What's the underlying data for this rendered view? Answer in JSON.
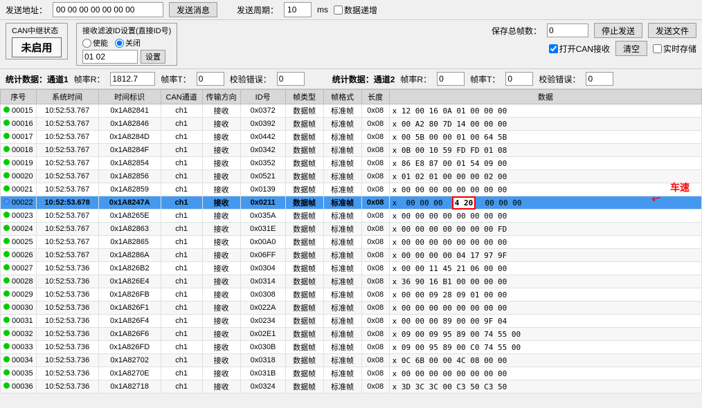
{
  "topbar": {
    "label_addr": "发送地址：",
    "addr_value": "00 00 00 00 00 00 00",
    "send_msg_btn": "发送消息",
    "label_period": "发送周期：",
    "period_value": "10",
    "period_unit": "ms",
    "checkbox_loop": "数据递增"
  },
  "can_status": {
    "section_label": "CAN中继状态",
    "status_value": "未启用"
  },
  "filter": {
    "section_label": "接收滤波ID设置(直接ID号)",
    "radio_enable": "使能",
    "radio_close": "关闭",
    "input_value": "01 02",
    "set_btn": "设置"
  },
  "right_controls": {
    "save_total_label": "保存总帧数：",
    "save_total_value": "0",
    "stop_send_btn": "停止发送",
    "send_file_btn": "发送文件",
    "open_can_label": "打开CAN接收",
    "clear_btn": "清空",
    "realtime_save_label": "实时存储"
  },
  "stats_ch1": {
    "label": "统计数据：通道1",
    "frame_rate_r_label": "帧率R：",
    "frame_rate_r": "1812.7",
    "frame_rate_t_label": "帧率T：",
    "frame_rate_t": "0",
    "check_err_label": "校验错误：",
    "check_err": "0"
  },
  "stats_ch2": {
    "label": "统计数据：通道2",
    "frame_rate_r_label": "帧率R：",
    "frame_rate_r": "0",
    "frame_rate_t_label": "帧率T：",
    "frame_rate_t": "0",
    "check_err_label": "校验错误：",
    "check_err": "0"
  },
  "table": {
    "headers": [
      "序号",
      "系统时间",
      "时间标识",
      "CAN通道",
      "传输方向",
      "ID号",
      "帧类型",
      "帧格式",
      "长度",
      "数据"
    ],
    "selected_row_index": 10,
    "rows": [
      {
        "id": "00015",
        "time": "10:52:53.767",
        "ts": "0x1A82841",
        "ch": "ch1",
        "dir": "接收",
        "msgid": "0x0372",
        "ftype": "数据帧",
        "fformat": "标准帧",
        "len": "0x08",
        "data": "x  12 00 16 0A 01 00 00 00",
        "dot": "green"
      },
      {
        "id": "00016",
        "time": "10:52:53.767",
        "ts": "0x1A82846",
        "ch": "ch1",
        "dir": "接收",
        "msgid": "0x0392",
        "ftype": "数据帧",
        "fformat": "标准帧",
        "len": "0x08",
        "data": "x  00 A2 80 7D 14 00 00 00",
        "dot": "green"
      },
      {
        "id": "00017",
        "time": "10:52:53.767",
        "ts": "0x1A8284D",
        "ch": "ch1",
        "dir": "接收",
        "msgid": "0x0442",
        "ftype": "数据帧",
        "fformat": "标准帧",
        "len": "0x08",
        "data": "x  00 5B 00 00 01 00 64 5B",
        "dot": "green"
      },
      {
        "id": "00018",
        "time": "10:52:53.767",
        "ts": "0x1A8284F",
        "ch": "ch1",
        "dir": "接收",
        "msgid": "0x0342",
        "ftype": "数据帧",
        "fformat": "标准帧",
        "len": "0x08",
        "data": "x  0B 00 10 59 FD FD 01 08",
        "dot": "green"
      },
      {
        "id": "00019",
        "time": "10:52:53.767",
        "ts": "0x1A82854",
        "ch": "ch1",
        "dir": "接收",
        "msgid": "0x0352",
        "ftype": "数据帧",
        "fformat": "标准帧",
        "len": "0x08",
        "data": "x  86 E8 87 00 01 54 09 00",
        "dot": "green"
      },
      {
        "id": "00020",
        "time": "10:52:53.767",
        "ts": "0x1A82856",
        "ch": "ch1",
        "dir": "接收",
        "msgid": "0x0521",
        "ftype": "数据帧",
        "fformat": "标准帧",
        "len": "0x08",
        "data": "x  01 02 01 00 00 00 02 00",
        "dot": "green"
      },
      {
        "id": "00021",
        "time": "10:52:53.767",
        "ts": "0x1A82859",
        "ch": "ch1",
        "dir": "接收",
        "msgid": "0x0139",
        "ftype": "数据帧",
        "fformat": "标准帧",
        "len": "0x08",
        "data": "x  00 00 00 00 00 00 00 00",
        "dot": "green"
      },
      {
        "id": "00022",
        "time": "10:52:53.678",
        "ts": "0x1A8247A",
        "ch": "ch1",
        "dir": "接收",
        "msgid": "0x0211",
        "ftype": "数据帧",
        "fformat": "标准帧",
        "len": "0x08",
        "data": "x  00 00 00  4 20  00 00 00",
        "dot": "blue",
        "selected": true,
        "highlight_col": 9
      },
      {
        "id": "00023",
        "time": "10:52:53.767",
        "ts": "0x1A8265E",
        "ch": "ch1",
        "dir": "接收",
        "msgid": "0x035A",
        "ftype": "数据帧",
        "fformat": "标准帧",
        "len": "0x08",
        "data": "x  00 00 00 00 00 00 00 00",
        "dot": "green"
      },
      {
        "id": "00024",
        "time": "10:52:53.767",
        "ts": "0x1A82863",
        "ch": "ch1",
        "dir": "接收",
        "msgid": "0x031E",
        "ftype": "数据帧",
        "fformat": "标准帧",
        "len": "0x08",
        "data": "x  00 00 00 00 00 00 00 FD",
        "dot": "green"
      },
      {
        "id": "00025",
        "time": "10:52:53.767",
        "ts": "0x1A82865",
        "ch": "ch1",
        "dir": "接收",
        "msgid": "0x00A0",
        "ftype": "数据帧",
        "fformat": "标准帧",
        "len": "0x08",
        "data": "x  00 00 00 00 00 00 00 00",
        "dot": "green"
      },
      {
        "id": "00026",
        "time": "10:52:53.767",
        "ts": "0x1A8286A",
        "ch": "ch1",
        "dir": "接收",
        "msgid": "0x06FF",
        "ftype": "数据帧",
        "fformat": "标准帧",
        "len": "0x08",
        "data": "x  00 00 00 00 04 17 97 9F",
        "dot": "green"
      },
      {
        "id": "00027",
        "time": "10:52:53.736",
        "ts": "0x1A826B2",
        "ch": "ch1",
        "dir": "接收",
        "msgid": "0x0304",
        "ftype": "数据帧",
        "fformat": "标准帧",
        "len": "0x08",
        "data": "x  00 00 11 45 21 06 00 00",
        "dot": "green"
      },
      {
        "id": "00028",
        "time": "10:52:53.736",
        "ts": "0x1A826E4",
        "ch": "ch1",
        "dir": "接收",
        "msgid": "0x0314",
        "ftype": "数据帧",
        "fformat": "标准帧",
        "len": "0x08",
        "data": "x  36 90 16 B1 00 00 00 00",
        "dot": "green"
      },
      {
        "id": "00029",
        "time": "10:52:53.736",
        "ts": "0x1A826FB",
        "ch": "ch1",
        "dir": "接收",
        "msgid": "0x0308",
        "ftype": "数据帧",
        "fformat": "标准帧",
        "len": "0x08",
        "data": "x  00 00 09 28 09 01 00 00",
        "dot": "green"
      },
      {
        "id": "00030",
        "time": "10:52:53.736",
        "ts": "0x1A826F1",
        "ch": "ch1",
        "dir": "接收",
        "msgid": "0x022A",
        "ftype": "数据帧",
        "fformat": "标准帧",
        "len": "0x08",
        "data": "x  00 00 00 00 00 00 00 00",
        "dot": "green"
      },
      {
        "id": "00031",
        "time": "10:52:53.736",
        "ts": "0x1A826F4",
        "ch": "ch1",
        "dir": "接收",
        "msgid": "0x0234",
        "ftype": "数据帧",
        "fformat": "标准帧",
        "len": "0x08",
        "data": "x  00 00 00 89 00 00 9F 04",
        "dot": "green"
      },
      {
        "id": "00032",
        "time": "10:52:53.736",
        "ts": "0x1A826F6",
        "ch": "ch1",
        "dir": "接收",
        "msgid": "0x02E1",
        "ftype": "数据帧",
        "fformat": "标准帧",
        "len": "0x08",
        "data": "x  09 00 09 95 89 00 74 55 00",
        "dot": "green"
      },
      {
        "id": "00033",
        "time": "10:52:53.736",
        "ts": "0x1A826FD",
        "ch": "ch1",
        "dir": "接收",
        "msgid": "0x030B",
        "ftype": "数据帧",
        "fformat": "标准帧",
        "len": "0x08",
        "data": "x  09 00 95 89 00 C0 74 55 00",
        "dot": "green"
      },
      {
        "id": "00034",
        "time": "10:52:53.736",
        "ts": "0x1A82702",
        "ch": "ch1",
        "dir": "接收",
        "msgid": "0x0318",
        "ftype": "数据帧",
        "fformat": "标准帧",
        "len": "0x08",
        "data": "x  0C 6B 00 00 4C 08 00 00",
        "dot": "green"
      },
      {
        "id": "00035",
        "time": "10:52:53.736",
        "ts": "0x1A8270E",
        "ch": "ch1",
        "dir": "接收",
        "msgid": "0x031B",
        "ftype": "数据帧",
        "fformat": "标准帧",
        "len": "0x08",
        "data": "x  00 00 00 00 00 00 00 00",
        "dot": "green"
      },
      {
        "id": "00036",
        "time": "10:52:53.736",
        "ts": "0x1A82718",
        "ch": "ch1",
        "dir": "接收",
        "msgid": "0x0324",
        "ftype": "数据帧",
        "fformat": "标准帧",
        "len": "0x08",
        "data": "x  3D 3C 3C 00 C3 50 C3 50",
        "dot": "green"
      }
    ]
  },
  "annotation": {
    "text": "车速"
  }
}
